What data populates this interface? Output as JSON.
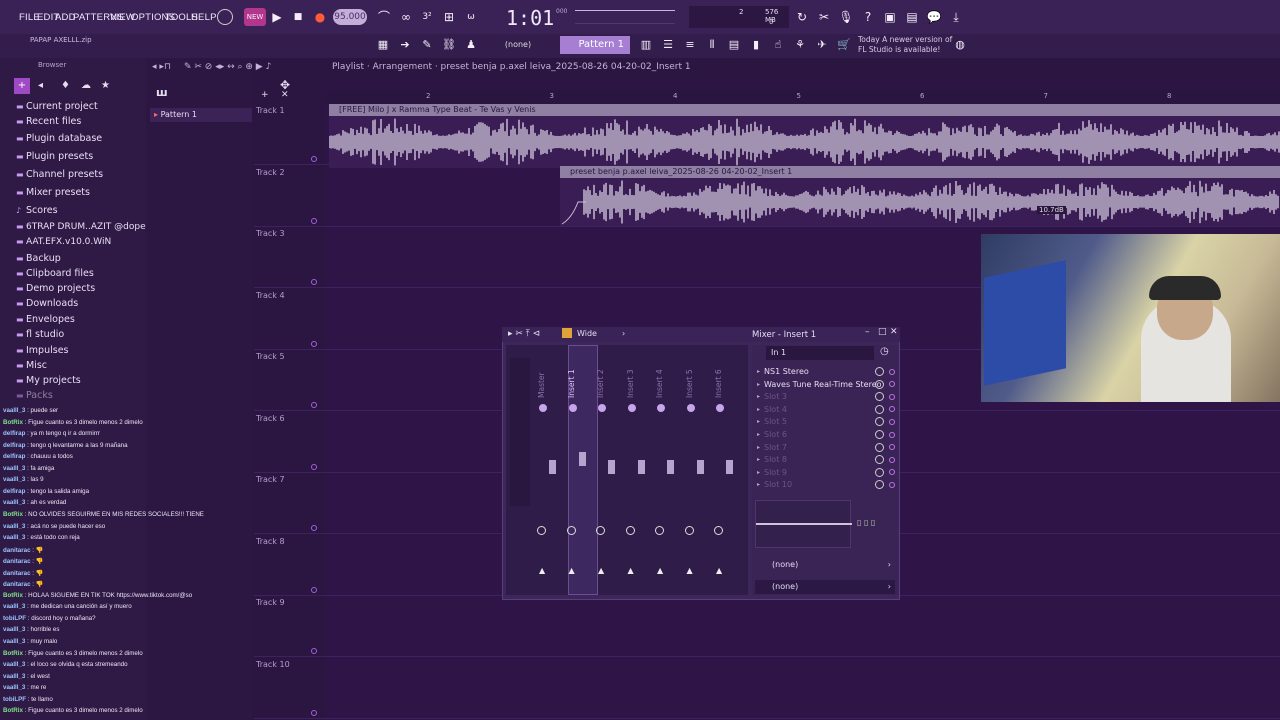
{
  "menu": [
    "FILE",
    "EDIT",
    "ADD",
    "PATTERNS",
    "VIEW",
    "OPTIONS",
    "TOOLS",
    "HELP"
  ],
  "transport": {
    "bpm": "95.000",
    "time": "1:01",
    "time_sub": "000",
    "cpu": "2",
    "mem": "576 MB",
    "voices": "0"
  },
  "toolbar2": {
    "none_label": "(none)",
    "pattern_label": "Pattern 1"
  },
  "news": {
    "line1": "Today  A newer version of",
    "line2": "FL Studio is available!"
  },
  "browser": {
    "header": "Browser",
    "items": [
      "Current project",
      "Recent files",
      "Plugin database",
      "Plugin presets",
      "Channel presets",
      "Mixer presets",
      "Scores",
      "6TRAP DRUM..AZIT @dopekit",
      "AAT.EFX.v10.0.WiN",
      "Backup",
      "Clipboard files",
      "Demo projects",
      "Downloads",
      "Envelopes",
      "fl studio",
      "Impulses",
      "Misc",
      "My projects",
      "Packs"
    ]
  },
  "patterns": {
    "item": "Pattern 1"
  },
  "playlist": {
    "title": "Playlist · Arrangement · preset benja p.axel leiva_2025-08-26 04-20-02_Insert 1",
    "ruler": [
      "2",
      "3",
      "4",
      "5",
      "6",
      "7",
      "8",
      "9"
    ],
    "tracks": [
      "Track 1",
      "Track 2",
      "Track 3",
      "Track 4",
      "Track 5",
      "Track 6",
      "Track 7",
      "Track 8",
      "Track 9",
      "Track 10"
    ],
    "clip1": "[FREE] Milo J x Ramma Type Beat - Te Vas y Venis",
    "clip2": "preset benja p.axel leiva_2025-08-26 04-20-02_Insert 1",
    "clip2_gain": "10.7dB"
  },
  "mixer": {
    "title": "Mixer - Insert 1",
    "mode": "Wide",
    "input": "In 1",
    "strips": [
      "Master",
      "Insert 1",
      "Insert 2",
      "Insert 3",
      "Insert 4",
      "Insert 5",
      "Insert 6"
    ],
    "slots": [
      "NS1 Stereo",
      "Waves Tune Real-Time Stereo",
      "Slot 3",
      "Slot 4",
      "Slot 5",
      "Slot 6",
      "Slot 7",
      "Slot 8",
      "Slot 9",
      "Slot 10"
    ],
    "out1": "(none)",
    "out2": "(none)"
  },
  "chat": [
    {
      "u": "vaalll_3",
      "m": "puede ser"
    },
    {
      "u": "BotRix",
      "m": "Figue cuanto es 3 dimelo menos 2 dimelo"
    },
    {
      "u": "delfirap",
      "m": "ya m tengo q ir a dormirrr"
    },
    {
      "u": "delfirap",
      "m": "tengo q levantarme a las 9 mañana"
    },
    {
      "u": "delfirap",
      "m": "chauuu a todos"
    },
    {
      "u": "vaalll_3",
      "m": "fa amiga"
    },
    {
      "u": "vaalll_3",
      "m": "las 9"
    },
    {
      "u": "delfirap",
      "m": "tengo la salida amiga"
    },
    {
      "u": "vaalll_3",
      "m": "ah es verdad"
    },
    {
      "u": "BotRix",
      "m": "NO OLVIDES SEGUIRME EN MIS REDES SOCIALES!!! TIENE"
    },
    {
      "u": "vaalll_3",
      "m": "acá no se puede hacer eso"
    },
    {
      "u": "vaalll_3",
      "m": "está todo con reja"
    },
    {
      "u": "danitarac",
      "m": "👎"
    },
    {
      "u": "danitarac",
      "m": "👎"
    },
    {
      "u": "danitarac",
      "m": "👎"
    },
    {
      "u": "danitarac",
      "m": "👎"
    },
    {
      "u": "BotRix",
      "m": "HOLAA SIGUEME EN TIK TOK https://www.tiktok.com/@so"
    },
    {
      "u": "vaalll_3",
      "m": "me dedican una canción así y muero"
    },
    {
      "u": "tobiLPF",
      "m": "discord hoy o mañana?"
    },
    {
      "u": "vaalll_3",
      "m": "horrible es"
    },
    {
      "u": "vaalll_3",
      "m": "muy malo"
    },
    {
      "u": "BotRix",
      "m": "Figue cuanto es 3 dimelo menos 2 dimelo"
    },
    {
      "u": "vaalll_3",
      "m": "el loco se olvida q esta stremeando"
    },
    {
      "u": "vaalll_3",
      "m": "el west"
    },
    {
      "u": "vaalll_3",
      "m": "me re"
    },
    {
      "u": "tobiLPF",
      "m": "te llamo"
    },
    {
      "u": "BotRix",
      "m": "Figue cuanto es 3 dimelo menos 2 dimelo"
    }
  ]
}
